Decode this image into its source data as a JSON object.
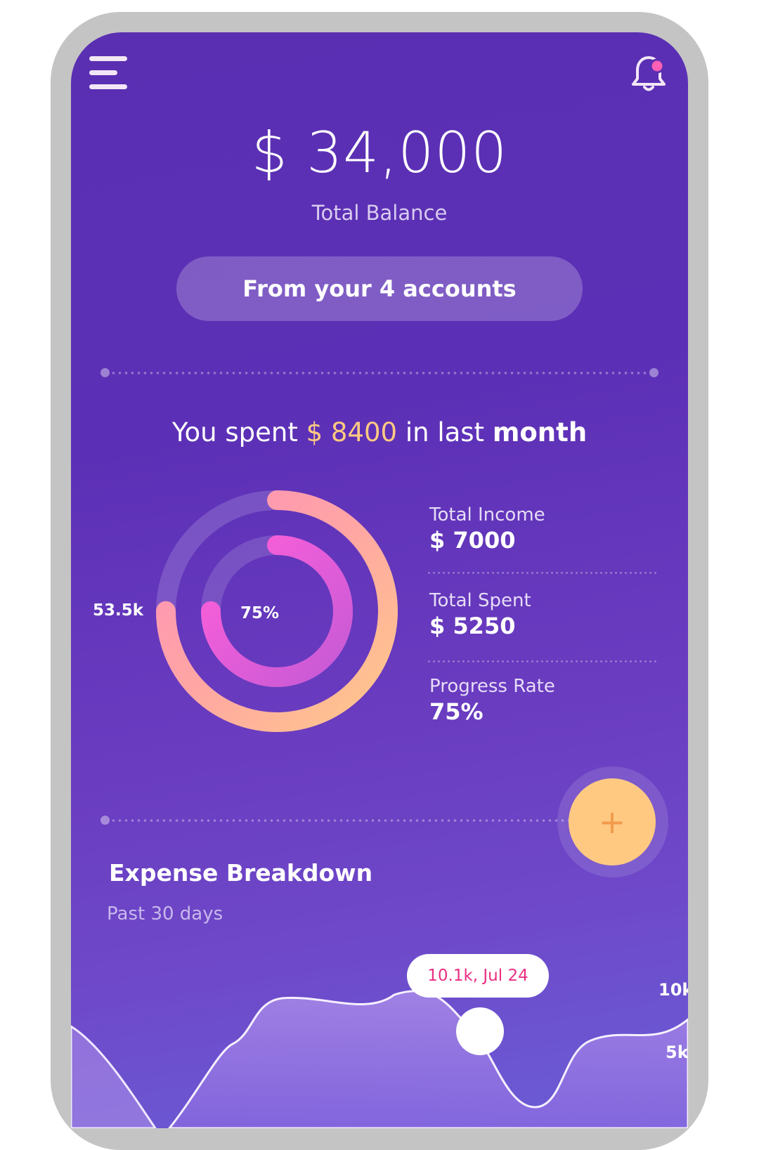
{
  "header": {
    "menu_icon": "hamburger-menu-icon",
    "notification_icon": "bell-icon",
    "notification_dot_color": "#ff5fb4"
  },
  "balance": {
    "amount": "$ 34,000",
    "label": "Total Balance"
  },
  "accounts_button": {
    "label": "From your 4 accounts"
  },
  "spending": {
    "prefix": "You spent ",
    "amount": "$ 8400",
    "middle": " in last ",
    "period": "month"
  },
  "rings": {
    "outer_label": "53.5k",
    "inner_label": "75%",
    "outer_progress": 0.75,
    "inner_progress": 0.75
  },
  "stats": [
    {
      "label": "Total Income",
      "value": "$ 7000"
    },
    {
      "label": "Total Spent",
      "value": "$ 5250"
    },
    {
      "label": "Progress Rate",
      "value": "75%"
    }
  ],
  "fab": {
    "label": "+"
  },
  "expense": {
    "title": "Expense Breakdown",
    "subtitle": "Past 30 days",
    "tooltip": "10.1k, Jul 24",
    "y_ticks": [
      "10k",
      "5k"
    ]
  },
  "colors": {
    "accent": "#ffc982",
    "pink": "#ff8fb9",
    "magenta": "#e64ddb",
    "background": "#5a2fb2"
  }
}
